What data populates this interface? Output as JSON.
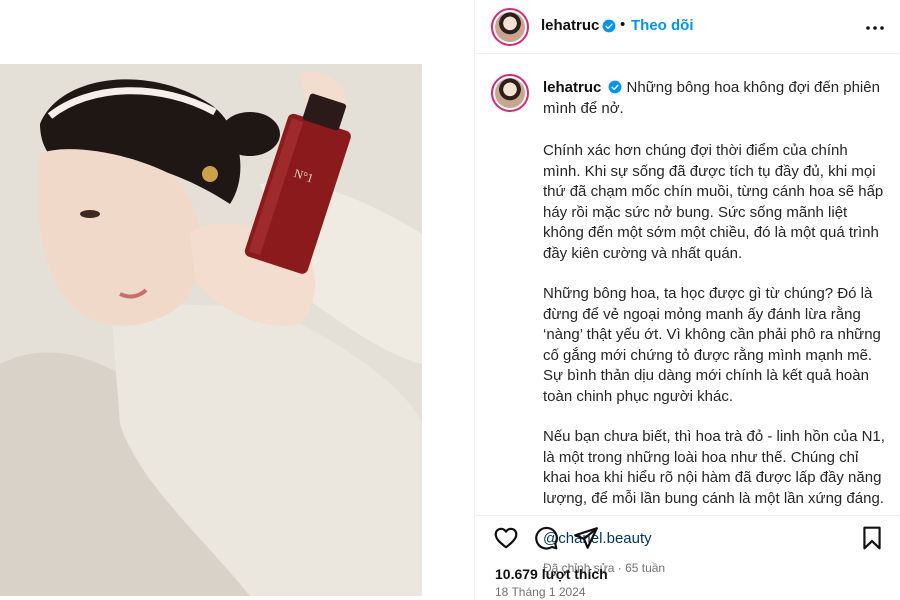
{
  "post": {
    "username": "lehatruc",
    "follow_label": "Theo dõi",
    "caption_lead": "Những bông hoa không đợi đến phiên mình để nở.",
    "paragraphs": [
      "Chính xác hơn chúng đợi thời điểm của chính mình. Khi sự sống đã được tích tụ đầy đủ, khi mọi thứ đã chạm mốc chín muồi, từng cánh hoa sẽ hấp háy rồi mặc sức nở bung. Sức sống mãnh liệt không đến một sớm một chiều, đó là một quá trình đầy kiên cường và nhất quán.",
      "Những bông hoa, ta học được gì từ chúng? Đó là đừng để vẻ ngoại mỏng manh ấy đánh lừa rằng ‘nàng’ thật yếu ớt. Vì không cần phải phô ra những cố gắng mới chứng tỏ được rằng mình mạnh mẽ. Sự bình thản dịu dàng mới chính là kết quả hoàn toàn chinh phục người khác.",
      "Nếu bạn chưa biết, thì hoa trà đỏ - linh hồn của N1, là một trong những loài hoa như thế. Chúng chỉ khai hoa khi hiểu rõ nội hàm đã được lấp đầy năng lượng, để mỗi lần bung cánh là một lần xứng đáng."
    ],
    "mention": "@chanel.beauty",
    "meta": "Đã chỉnh sửa · 65 tuần",
    "likes": "10.679 lượt thích",
    "date": "18 Tháng 1 2024"
  },
  "icons": {
    "verified": "verified-badge-icon",
    "more": "more-options-icon",
    "like": "heart-icon",
    "comment": "comment-icon",
    "share": "share-icon",
    "save": "bookmark-icon"
  },
  "colors": {
    "accent": "#0095f6",
    "verified": "#0095f6",
    "text": "#262626",
    "muted": "#737373",
    "bottle": "#8b1a1c"
  }
}
